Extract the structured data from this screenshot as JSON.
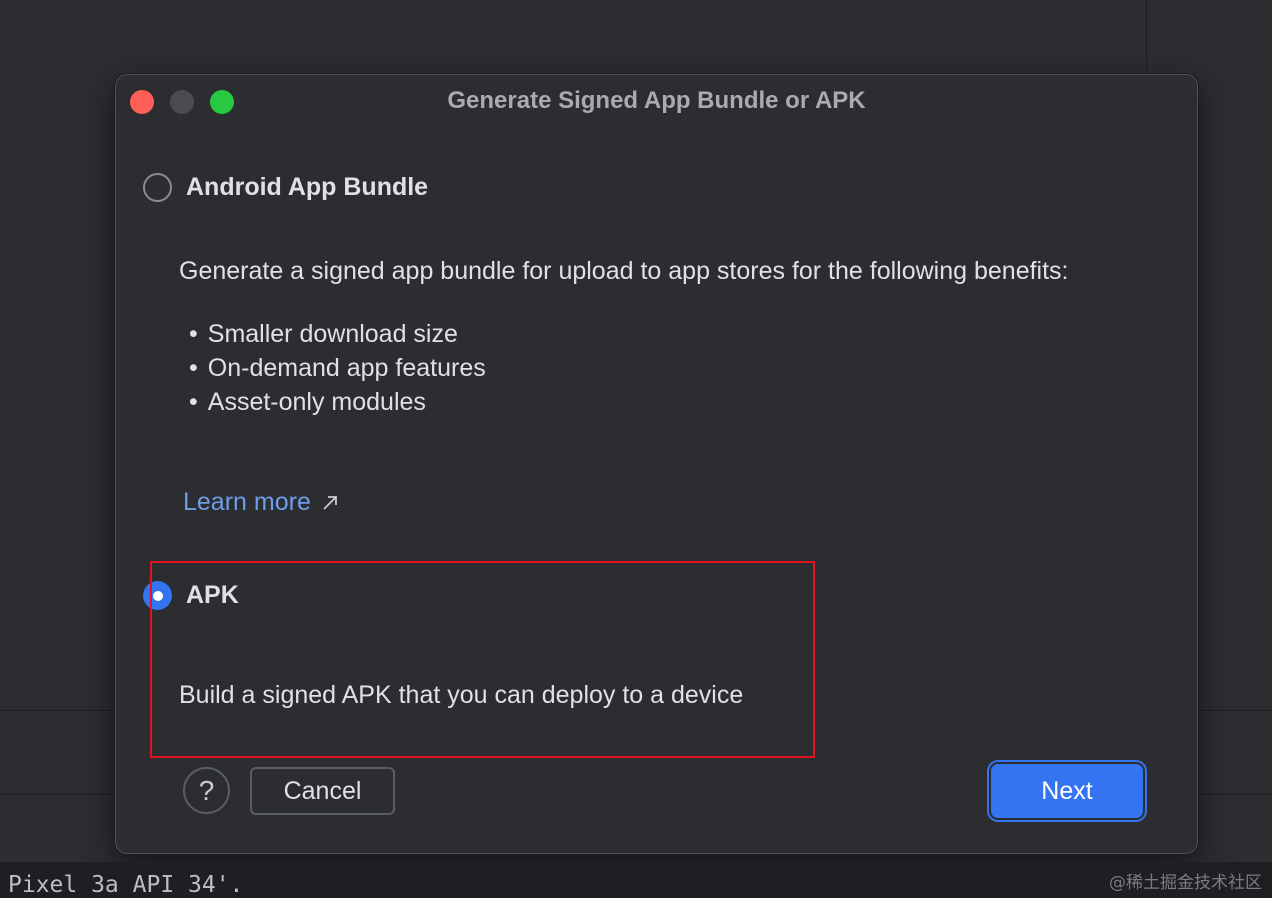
{
  "dialog": {
    "title": "Generate Signed App Bundle or APK",
    "traffic_lights": {
      "close": "#ff5f57",
      "minimize": "#4a4c50",
      "zoom": "#28c840"
    }
  },
  "options": {
    "bundle": {
      "label": "Android App Bundle",
      "selected": false,
      "description": "Generate a signed app bundle for upload to app stores for the following benefits:",
      "benefits": [
        "Smaller download size",
        "On-demand app features",
        "Asset-only modules"
      ],
      "learn_more": "Learn more"
    },
    "apk": {
      "label": "APK",
      "selected": true,
      "description": "Build a signed APK that you can deploy to a device"
    }
  },
  "buttons": {
    "help": "?",
    "cancel": "Cancel",
    "next": "Next"
  },
  "console": {
    "text": "Pixel 3a API 34'."
  },
  "watermark": "@稀土掘金技术社区",
  "colors": {
    "accent": "#3574f0",
    "link": "#6d9ee8",
    "highlight": "#e0141e",
    "background": "#2b2d30"
  }
}
